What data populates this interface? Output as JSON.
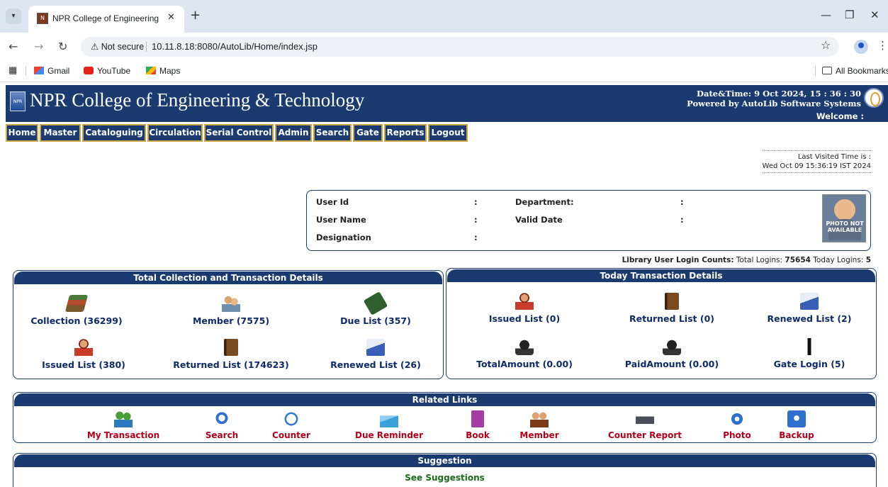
{
  "browser": {
    "tab_title": "NPR College of Engineering & T",
    "tab_favicon": "college-favicon",
    "new_tab": "+",
    "not_secure": "Not secure",
    "url": "10.11.8.18:8080/AutoLib/Home/index.jsp",
    "bookmarks": [
      "Gmail",
      "YouTube",
      "Maps"
    ],
    "all_bookmarks": "All Bookmarks"
  },
  "header": {
    "title": "NPR College of Engineering & Technology",
    "logo_text": "NPR",
    "datetime": "Date&Time:  9 Oct 2024, 15 : 36 : 30",
    "powered_by": "Powered by AutoLib Software Systems",
    "welcome": "Welcome   :"
  },
  "menu": [
    "Home",
    "Master",
    "Cataloguing",
    "Circulation",
    "Serial Control",
    "Admin",
    "Search",
    "Gate",
    "Reports",
    "Logout"
  ],
  "last_visited": {
    "label": "Last Visited Time is :",
    "value": "Wed Oct 09 15:36:19 IST 2024"
  },
  "user": {
    "user_id_label": "User Id",
    "user_name_label": "User Name",
    "designation_label": "Designation",
    "department_label": "Department:",
    "valid_date_label": "Valid Date",
    "colon": ":",
    "photo_text": "PHOTO NOT AVAILABLE"
  },
  "login_counts": {
    "label": "Library User Login Counts:",
    "total_label": "Total Logins:",
    "total": "75654",
    "today_label": "Today Logins:",
    "today": "5"
  },
  "total_panel": {
    "title": "Total Collection and Transaction Details",
    "tiles": [
      {
        "label": "Collection (36299)",
        "icon": "books-stack-icon"
      },
      {
        "label": "Member (7575)",
        "icon": "members-icon"
      },
      {
        "label": "Due List (357)",
        "icon": "green-book-icon"
      },
      {
        "label": "Issued List (380)",
        "icon": "reader-icon"
      },
      {
        "label": "Returned List (174623)",
        "icon": "brown-book-icon"
      },
      {
        "label": "Renewed List (26)",
        "icon": "blue-book-icon"
      }
    ]
  },
  "today_panel": {
    "title": "Today Transaction Details",
    "tiles": [
      {
        "label": "Issued List (0)",
        "icon": "reader-icon"
      },
      {
        "label": "Returned List (0)",
        "icon": "brown-book-icon"
      },
      {
        "label": "Renewed List (2)",
        "icon": "blue-book-icon"
      },
      {
        "label": "TotalAmount (0.00)",
        "icon": "money-hand-icon"
      },
      {
        "label": "PaidAmount (0.00)",
        "icon": "money-hand-icon"
      },
      {
        "label": "Gate Login (5)",
        "icon": "gate-person-icon"
      }
    ]
  },
  "related_links": {
    "title": "Related Links",
    "items": [
      {
        "label": "My Transaction",
        "icon": "transaction-icon"
      },
      {
        "label": "Search",
        "icon": "search-icon"
      },
      {
        "label": "Counter",
        "icon": "counter-icon"
      },
      {
        "label": "Due Reminder",
        "icon": "mail-icon"
      },
      {
        "label": "Book",
        "icon": "book-icon"
      },
      {
        "label": "Member",
        "icon": "member-icon"
      },
      {
        "label": "Counter Report",
        "icon": "printer-icon"
      },
      {
        "label": "Photo",
        "icon": "photo-icon"
      },
      {
        "label": "Backup",
        "icon": "backup-icon"
      }
    ]
  },
  "suggestion": {
    "title": "Suggestion",
    "link": "See Suggestions"
  },
  "colors": {
    "navy": "#1a3a70",
    "menu_border": "#c9a646",
    "tile_text": "#0d2a6b",
    "link_text": "#b3001b",
    "suggest_text": "#1b6b1b"
  }
}
